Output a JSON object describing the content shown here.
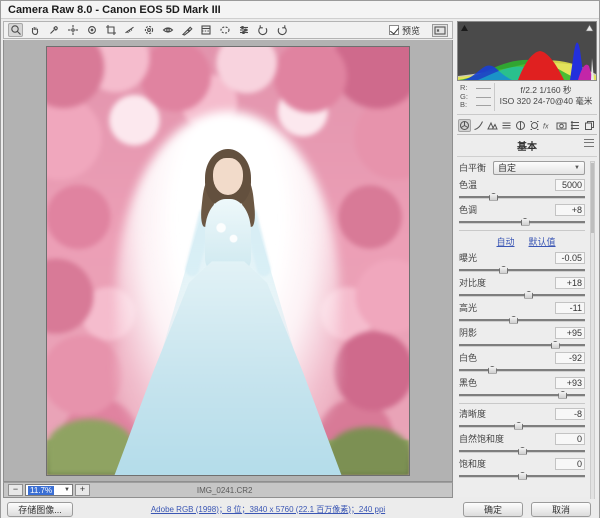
{
  "window": {
    "title": "Camera Raw 8.0 -  Canon EOS 5D Mark III"
  },
  "toolbar": {
    "preview_label": "预览"
  },
  "histogram": {
    "rgb": [
      {
        "label": "R:",
        "value": "——"
      },
      {
        "label": "G:",
        "value": "——"
      },
      {
        "label": "B:",
        "value": "——"
      }
    ],
    "exif_line1": "f/2.2  1/160 秒",
    "exif_line2": "ISO 320  24-70@40 毫米"
  },
  "panel": {
    "title": "基本",
    "white_balance": {
      "label": "白平衡",
      "value": "自定"
    },
    "auto_label": "自动",
    "default_label": "默认值",
    "slider_groups": [
      [
        {
          "label": "色温",
          "value": "5000",
          "pos": 27
        },
        {
          "label": "色调",
          "value": "+8",
          "pos": 52
        }
      ],
      [
        {
          "label": "曝光",
          "value": "-0.05",
          "pos": 35
        },
        {
          "label": "对比度",
          "value": "+18",
          "pos": 55
        },
        {
          "label": "高光",
          "value": "-11",
          "pos": 43
        },
        {
          "label": "阴影",
          "value": "+95",
          "pos": 76
        },
        {
          "label": "白色",
          "value": "-92",
          "pos": 26
        },
        {
          "label": "黑色",
          "value": "+93",
          "pos": 82
        }
      ],
      [
        {
          "label": "清晰度",
          "value": "-8",
          "pos": 47
        },
        {
          "label": "自然饱和度",
          "value": "0",
          "pos": 50
        },
        {
          "label": "饱和度",
          "value": "0",
          "pos": 50
        }
      ]
    ]
  },
  "statusbar": {
    "minus": "−",
    "plus": "+",
    "zoom_value": "11.7%",
    "filename": "IMG_0241.CR2"
  },
  "footer": {
    "save_button": "存储图像...",
    "workflow_link": "Adobe RGB (1998)；8 位；3840 x 5760 (22.1 百万像素)；240 ppi",
    "ok_button": "确定",
    "cancel_button": "取消"
  }
}
